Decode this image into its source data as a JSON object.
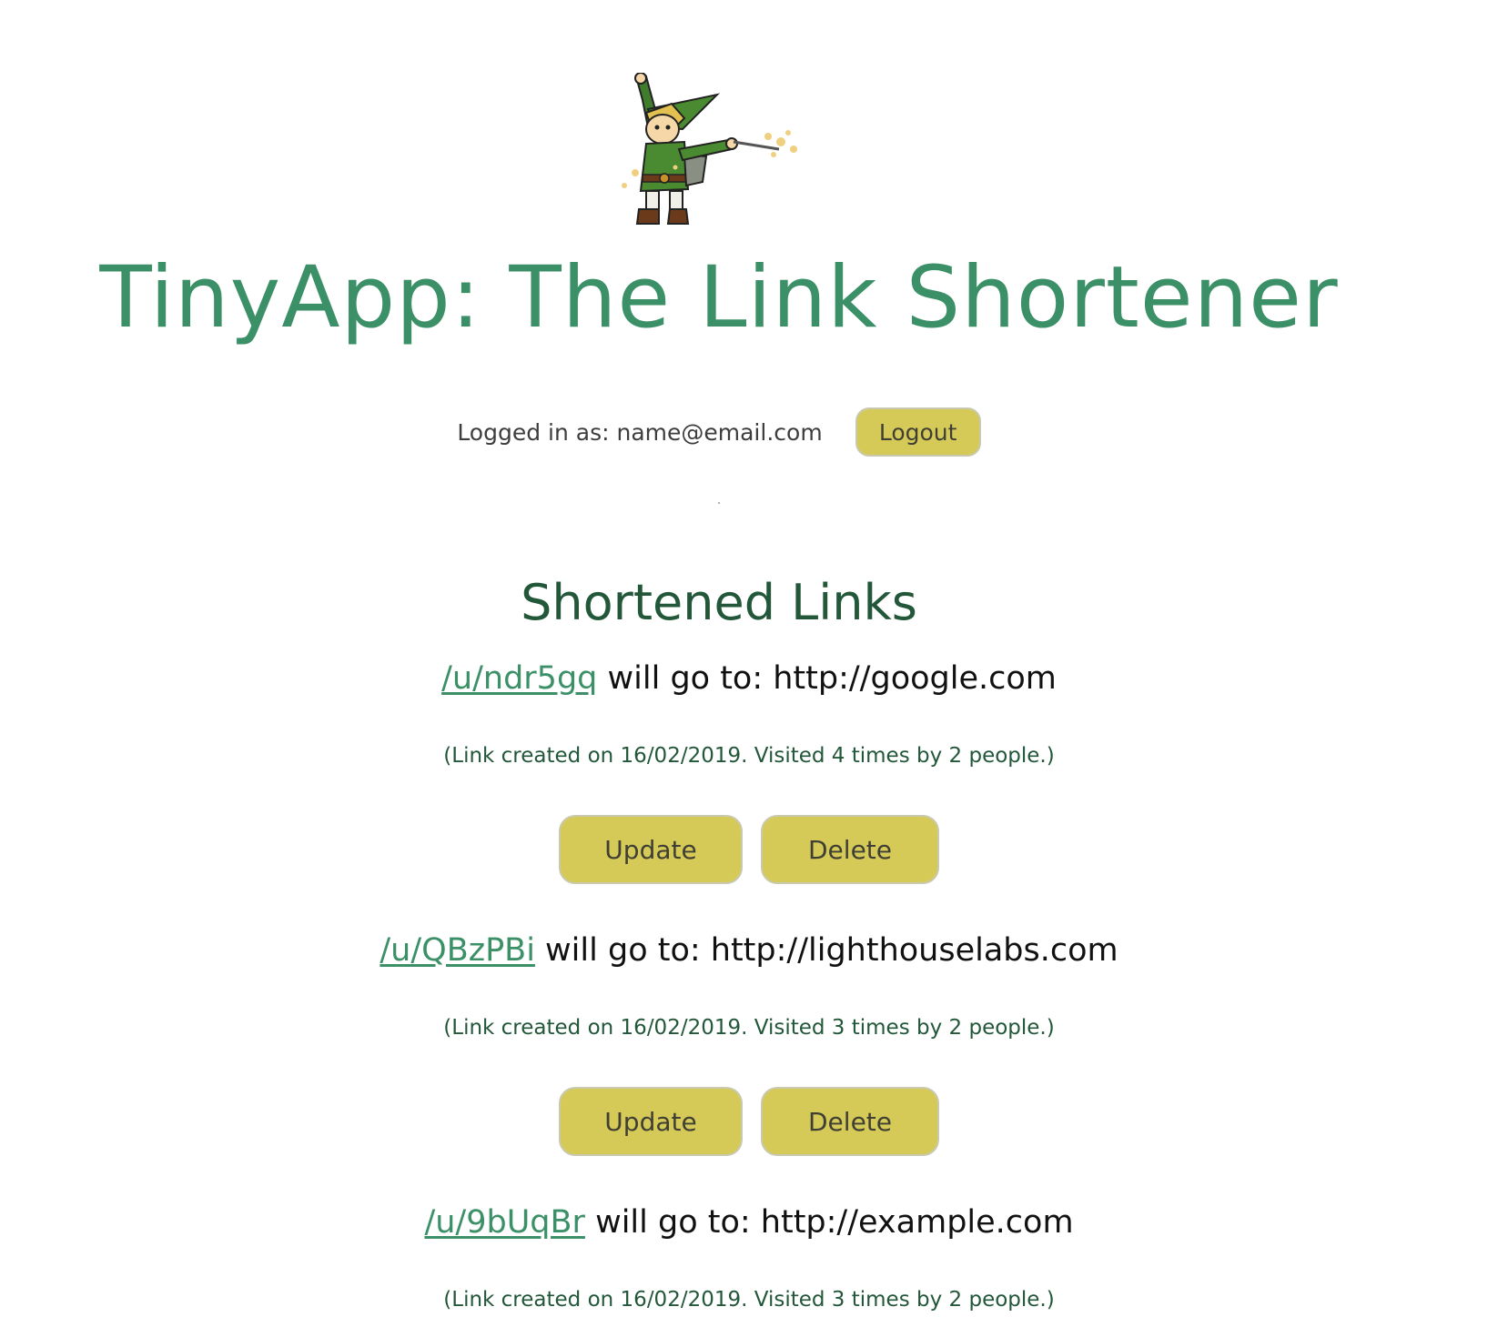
{
  "header": {
    "logo_icon": "wizard-mascot-icon",
    "title": "TinyApp: The Link Shortener"
  },
  "auth": {
    "logged_in_text": "Logged in as: name@email.com",
    "logout_label": "Logout"
  },
  "links_section": {
    "heading": "Shortened Links",
    "links": [
      {
        "short_url": "/u/ndr5gq",
        "goes_to_text": " will go to: http://google.com",
        "meta": "(Link created on 16/02/2019. Visited 4 times by 2 people.)",
        "update_label": "Update",
        "delete_label": "Delete"
      },
      {
        "short_url": "/u/QBzPBi",
        "goes_to_text": " will go to: http://lighthouselabs.com",
        "meta": "(Link created on 16/02/2019. Visited 3 times by 2 people.)",
        "update_label": "Update",
        "delete_label": "Delete"
      },
      {
        "short_url": "/u/9bUqBr",
        "goes_to_text": " will go to: http://example.com",
        "meta": "(Link created on 16/02/2019. Visited 3 times by 2 people.)"
      }
    ]
  },
  "colors": {
    "title_green": "#3c9068",
    "dark_green": "#235739",
    "button_yellow": "#d5ca58"
  }
}
